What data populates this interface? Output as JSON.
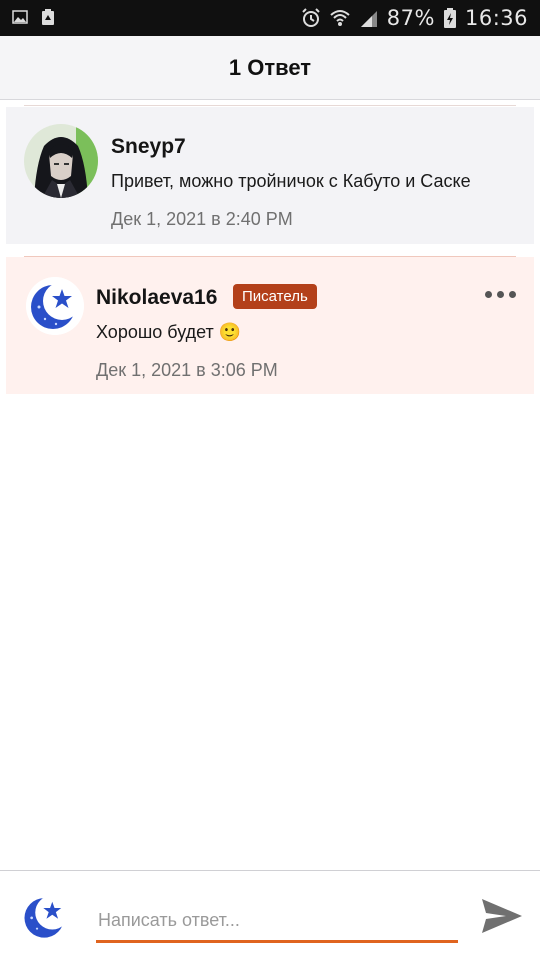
{
  "status_bar": {
    "battery": "87%",
    "time": "16:36",
    "icons": [
      "image-icon",
      "recycle-icon",
      "alarm-icon",
      "wifi-icon",
      "signal-icon",
      "battery-icon"
    ]
  },
  "header": {
    "title": "1 Ответ"
  },
  "comments": [
    {
      "author": "Sneyp7",
      "text": "Привет, можно тройничок с Кабуто и Саске",
      "date": "Дек 1, 2021 в 2:40 PM",
      "avatar": "anime-character-avatar",
      "background": "#f3f3f6"
    },
    {
      "author": "Nikolaeva16",
      "badge": "Писатель",
      "badge_color": "#b3401a",
      "text": "Хорошо будет 🙂",
      "date": "Дек 1, 2021 в 3:06 PM",
      "avatar": "moon-star-avatar",
      "background": "#fff1ee"
    }
  ],
  "reply": {
    "placeholder": "Написать ответ...",
    "accent_color": "#e0641f"
  },
  "colors": {
    "accent": "#e0641f",
    "divider": "#f0c8bd",
    "header_bg": "#f5f5f7"
  }
}
